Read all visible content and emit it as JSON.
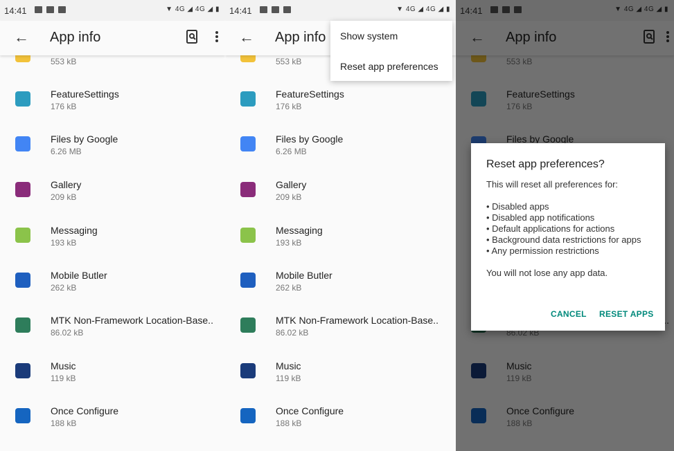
{
  "status": {
    "time": "14:41",
    "right": "▼ 4G ◢ 4G ◢ ▮"
  },
  "toolbar": {
    "title": "App info"
  },
  "apps": [
    {
      "name": "",
      "size": "553 kB",
      "color": "#f2c23a"
    },
    {
      "name": "FeatureSettings",
      "size": "176 kB",
      "color": "#2c9cbf"
    },
    {
      "name": "Files by Google",
      "size": "6.26 MB",
      "color": "#4285f4"
    },
    {
      "name": "Gallery",
      "size": "209 kB",
      "color": "#8a2c7a"
    },
    {
      "name": "Messaging",
      "size": "193 kB",
      "color": "#8bc34a"
    },
    {
      "name": "Mobile Butler",
      "size": "262 kB",
      "color": "#1e5fbf"
    },
    {
      "name": "MTK Non-Framework Location-Base..",
      "size": "86.02 kB",
      "color": "#2e7d5b"
    },
    {
      "name": "Music",
      "size": "119 kB",
      "color": "#1a3b7a"
    },
    {
      "name": "Once Configure",
      "size": "188 kB",
      "color": "#1565c0"
    }
  ],
  "menu": {
    "show_system": "Show system",
    "reset_prefs": "Reset app preferences"
  },
  "dialog": {
    "title": "Reset app preferences?",
    "intro": "This will reset all preferences for:",
    "items": [
      "• Disabled apps",
      "• Disabled app notifications",
      "• Default applications for actions",
      "• Background data restrictions for apps",
      "• Any permission restrictions"
    ],
    "outro": "You will not lose any app data.",
    "cancel": "CANCEL",
    "reset": "RESET APPS"
  }
}
